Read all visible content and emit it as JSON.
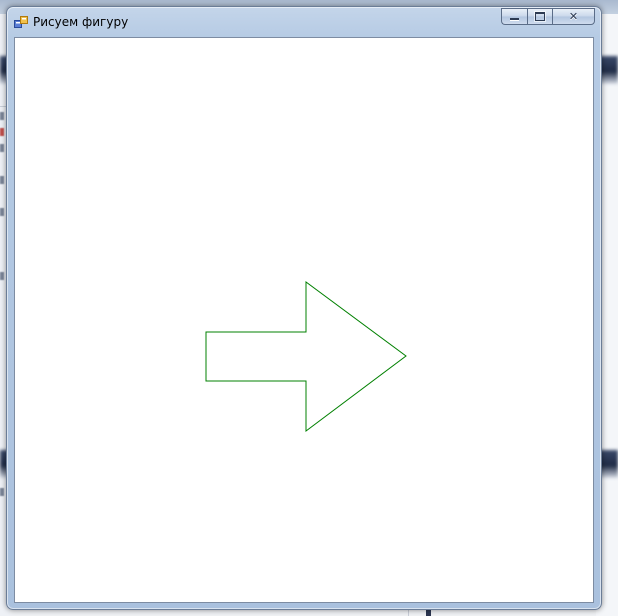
{
  "window": {
    "title": "Рисуем фигуру",
    "icon": "application-form-icon",
    "caption_buttons": [
      {
        "name": "minimize",
        "icon": "minimize-icon"
      },
      {
        "name": "maximize",
        "icon": "maximize-icon"
      },
      {
        "name": "close",
        "icon": "close-icon"
      }
    ]
  },
  "canvas": {
    "background": "#ffffff",
    "shape": {
      "type": "arrow",
      "stroke": "#008000",
      "fill": "none"
    }
  }
}
